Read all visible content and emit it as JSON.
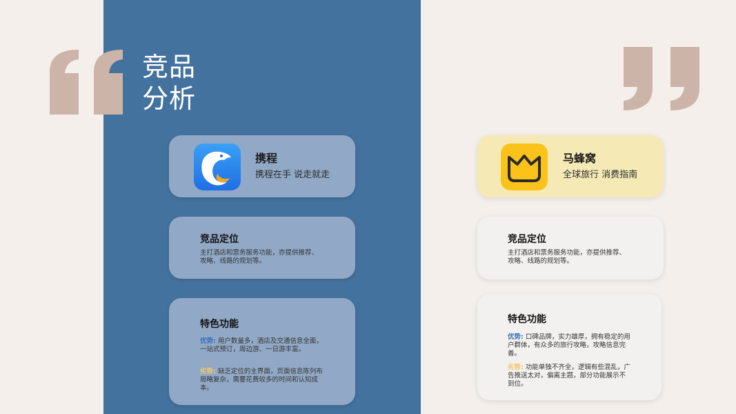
{
  "title": {
    "line1": "竞品",
    "line2": "分析"
  },
  "colors": {
    "background": "#f4efeb",
    "panel": "#44729e",
    "quote_mark": "#cdb4a8",
    "advantage_label": "#3b6fb8",
    "disadvantage_label": "#f3c76a"
  },
  "left": {
    "app": {
      "name": "携程",
      "slogan": "携程在手 说走就走",
      "icon": "dolphin-icon"
    },
    "positioning": {
      "title": "竞品定位",
      "text": "主打酒店和票务服务功能，亦提供推荐、攻略、线路的规划等。"
    },
    "features": {
      "title": "特色功能",
      "advantage_label": "优势:",
      "advantage_text": "用户数量多，酒店及交通信息全面，一站式预订，周边游、一日游丰富。",
      "disadvantage_label": "劣势:",
      "disadvantage_text": "缺乏定位的主界面，页面信息陈列布局略复杂，需要花费较多的时间和认知成本。"
    }
  },
  "right": {
    "app": {
      "name": "马蜂窝",
      "slogan": "全球旅行 消费指南",
      "icon": "crown-face-icon"
    },
    "positioning": {
      "title": "竞品定位",
      "text": "主打酒店和票务服务功能，亦提供推荐、攻略、线路的规划等。"
    },
    "features": {
      "title": "特色功能",
      "advantage_label": "优势:",
      "advantage_text": "口碑品牌，实力雄厚，拥有稳定的用户群体，有众多的旅行攻略，攻略信息完善。",
      "disadvantage_label": "劣势:",
      "disadvantage_text": "功能单独不齐全，逻辑有些混乱，广告推送太对，偏离主题，部分功能展示不到位。"
    }
  }
}
